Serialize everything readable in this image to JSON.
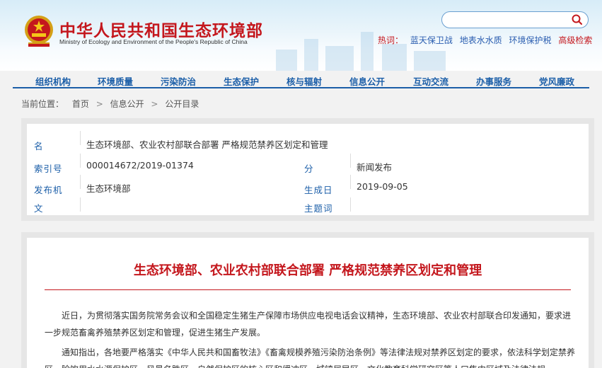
{
  "header": {
    "title": "中华人民共和国生态环境部",
    "subtitle": "Ministry of Ecology and Environment of the People's Republic of China",
    "search": {
      "placeholder": ""
    },
    "hotwords": {
      "label": "热词：",
      "links": [
        "蓝天保卫战",
        "地表水水质",
        "环境保护税"
      ],
      "advanced": "高级检索"
    }
  },
  "nav": {
    "items": [
      "组织机构",
      "环境质量",
      "污染防治",
      "生态保护",
      "核与辐射",
      "信息公开",
      "互动交流",
      "办事服务",
      "党风廉政"
    ]
  },
  "breadcrumb": {
    "label": "当前位置：",
    "items": [
      "首页",
      "信息公开",
      "公开目录"
    ],
    "separator": ">"
  },
  "info": {
    "name_label": "名",
    "name_value": "生态环境部、农业农村部联合部署 严格规范禁养区划定和管理",
    "index_label": "索引号",
    "index_value": "000014672/2019-01374",
    "category_label": "分",
    "category_value": "新闻发布",
    "publisher_label": "发布机",
    "publisher_value": "生态环境部",
    "date_label": "生成日",
    "date_value": "2019-09-05",
    "docno_label": "文",
    "docno_value": "",
    "subject_label": "主题词",
    "subject_value": ""
  },
  "article": {
    "title": "生态环境部、农业农村部联合部署 严格规范禁养区划定和管理",
    "paragraphs": [
      "近日，为贯彻落实国务院常务会议和全国稳定生猪生产保障市场供应电视电话会议精神，生态环境部、农业农村部联合印发通知，要求进一步规范畜禽养殖禁养区划定和管理，促进生猪生产发展。",
      "通知指出，各地要严格落实《中华人民共和国畜牧法》《畜禽规模养殖污染防治条例》等法律法规对禁养区划定的要求，依法科学划定禁养区。除饮用水水源保护区，风景名胜区，自然保护区的核心区和缓冲区，城镇居民区、文化教育科学研究区等人口集中区域及法律法规"
    ]
  }
}
